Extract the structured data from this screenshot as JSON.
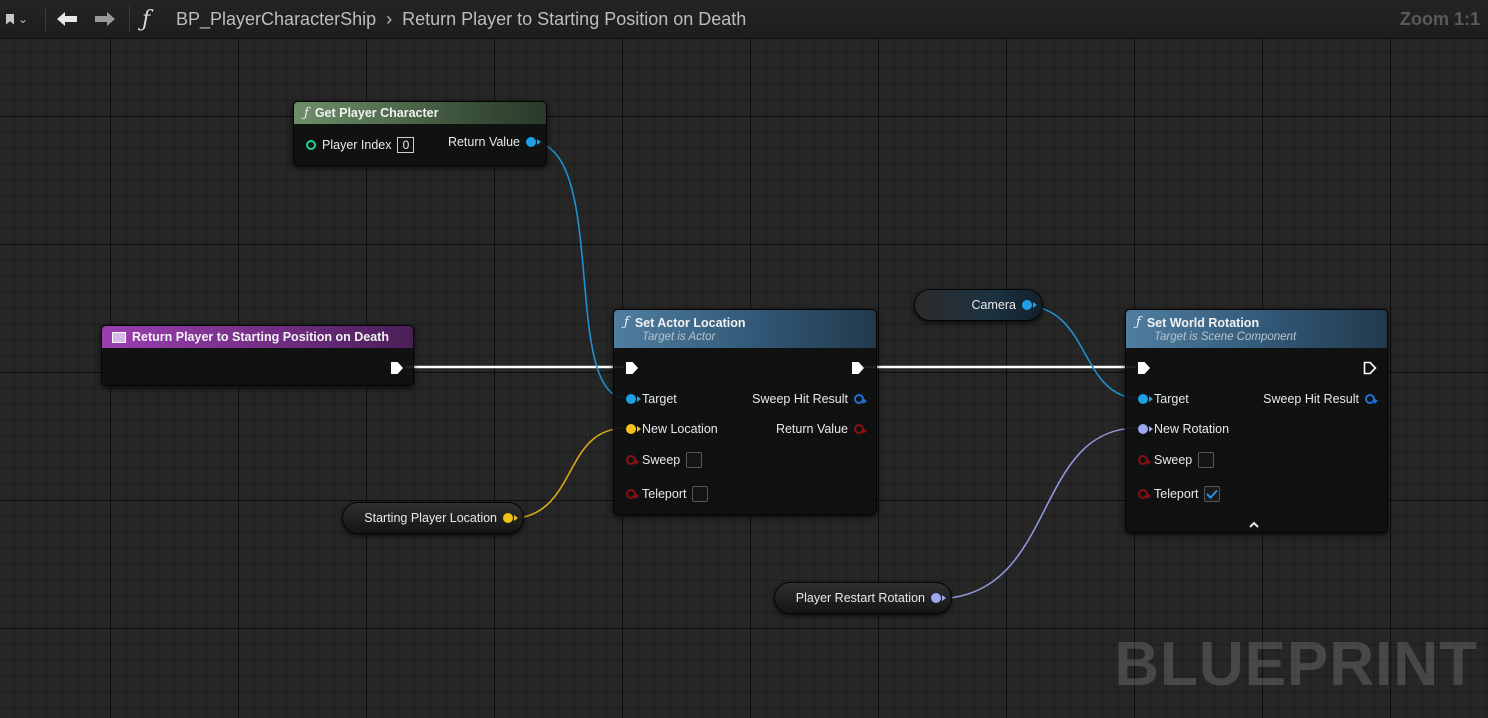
{
  "breadcrumb": {
    "blueprint": "BP_PlayerCharacterShip",
    "function": "Return Player to Starting Position on Death"
  },
  "zoom": "Zoom 1:1",
  "nodes": {
    "get_player_character": {
      "title": "Get Player Character",
      "player_index_label": "Player Index",
      "player_index_value": "0",
      "return_value_label": "Return Value"
    },
    "entry": {
      "title": "Return Player to Starting Position on Death"
    },
    "set_actor_location": {
      "title": "Set Actor Location",
      "subtitle": "Target is Actor",
      "target": "Target",
      "new_location": "New Location",
      "sweep": "Sweep",
      "teleport": "Teleport",
      "sweep_hit_result": "Sweep Hit Result",
      "return_value": "Return Value",
      "sweep_checked": false,
      "teleport_checked": false
    },
    "set_world_rotation": {
      "title": "Set World Rotation",
      "subtitle": "Target is Scene Component",
      "target": "Target",
      "new_rotation": "New Rotation",
      "sweep": "Sweep",
      "teleport": "Teleport",
      "sweep_hit_result": "Sweep Hit Result",
      "sweep_checked": false,
      "teleport_checked": true
    }
  },
  "variables": {
    "camera": "Camera",
    "starting_location": "Starting Player Location",
    "restart_rotation": "Player Restart Rotation"
  },
  "watermark": "BLUEPRINT",
  "colors": {
    "object_pin": "#1ea0e6",
    "vector_pin": "#f2c21a",
    "rotator_pin": "#9ea8ee",
    "bool_pin": "#8a1010",
    "int_pin": "#20d09a",
    "exec_wire": "#ffffff"
  }
}
